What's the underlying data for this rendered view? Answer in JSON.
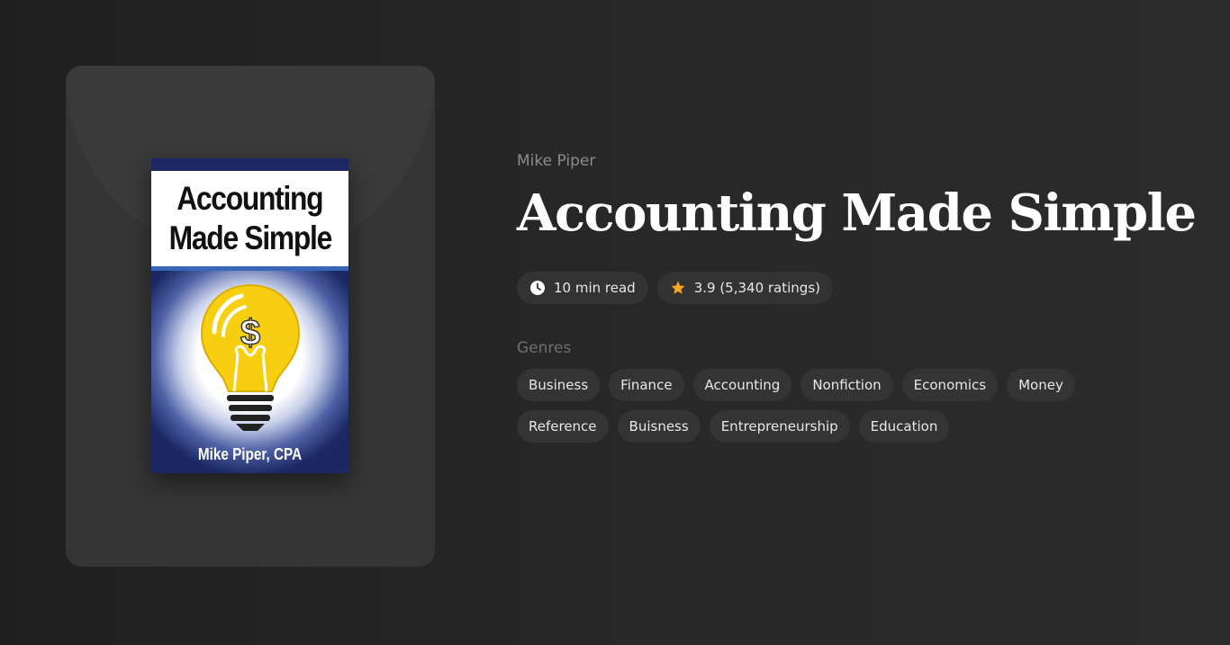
{
  "book": {
    "author": "Mike Piper",
    "title": "Accounting Made Simple",
    "cover": {
      "title_line1": "Accounting",
      "title_line2": "Made Simple",
      "author_line": "Mike Piper, CPA",
      "symbol": "$"
    }
  },
  "meta": {
    "read_time": "10 min read",
    "rating": "3.9 (5,340 ratings)",
    "read_time_icon": "clock-icon",
    "rating_icon": "star-icon",
    "star_color": "#f5a623"
  },
  "genres": {
    "label": "Genres",
    "items": [
      "Business",
      "Finance",
      "Accounting",
      "Nonfiction",
      "Economics",
      "Money",
      "Reference",
      "Buisness",
      "Entrepreneurship",
      "Education"
    ]
  }
}
